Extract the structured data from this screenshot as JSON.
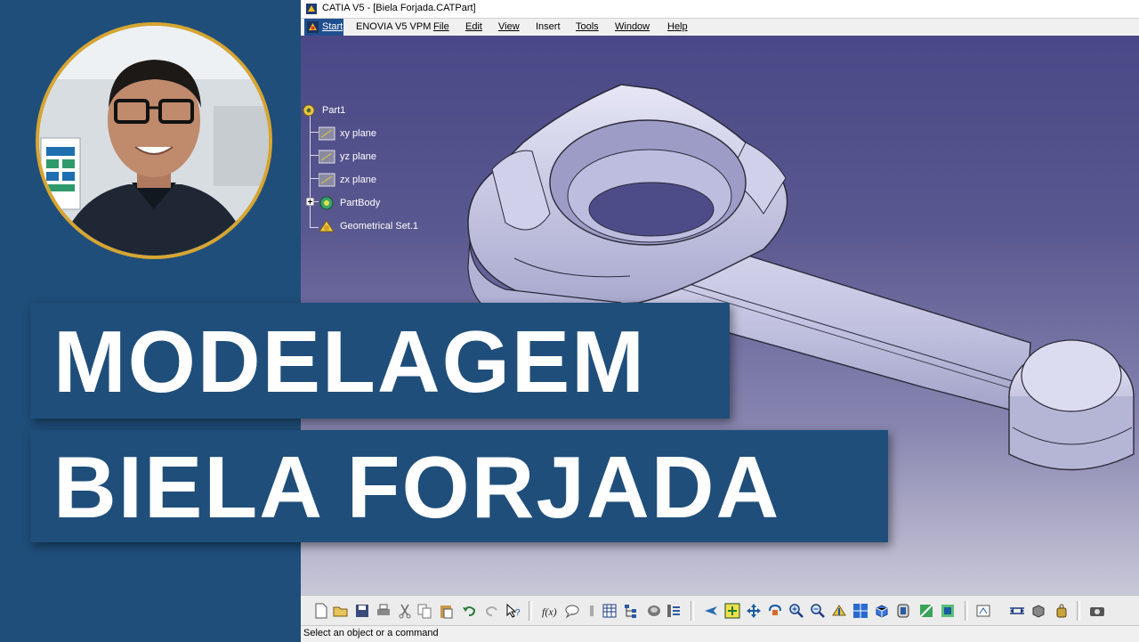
{
  "window": {
    "title": "CATIA V5 - [Biela Forjada.CATPart]"
  },
  "menu": {
    "start": "Start",
    "items": [
      "ENOVIA V5 VPM",
      "File",
      "Edit",
      "View",
      "Insert",
      "Tools",
      "Window",
      "Help"
    ]
  },
  "tree": {
    "root": "Part1",
    "items": [
      "xy plane",
      "yz plane",
      "zx plane",
      "PartBody",
      "Geometrical Set.1"
    ]
  },
  "headline": {
    "line1": "MODELAGEM",
    "line2": "BIELA FORJADA"
  },
  "status": {
    "text": "Select an object or a command"
  },
  "colors": {
    "panel_blue": "#1f4e7a",
    "frame_gold": "#d6a531",
    "viewport_top": "#4a4886",
    "viewport_bottom": "#c9c8d8",
    "part_surface": "#c8c8e8"
  },
  "icons": {
    "toolbar": [
      "new-icon",
      "open-icon",
      "save-icon",
      "print-icon",
      "cut-icon",
      "copy-icon",
      "paste-icon",
      "undo-icon",
      "redo-icon",
      "whats-this-icon",
      "formula-icon",
      "comment-icon",
      "knowledge-icon",
      "table-icon",
      "tree-icon",
      "catalog-icon",
      "settings-icon",
      "fly-icon",
      "fit-all-icon",
      "pan-icon",
      "rotate-icon",
      "zoom-in-icon",
      "zoom-out-icon",
      "normal-view-icon",
      "multi-view-icon",
      "iso-view-icon",
      "render-style-icon",
      "hide-show-icon",
      "swap-icon",
      "analysis-icon",
      "measure-icon",
      "inertia-icon",
      "photo-icon"
    ]
  }
}
